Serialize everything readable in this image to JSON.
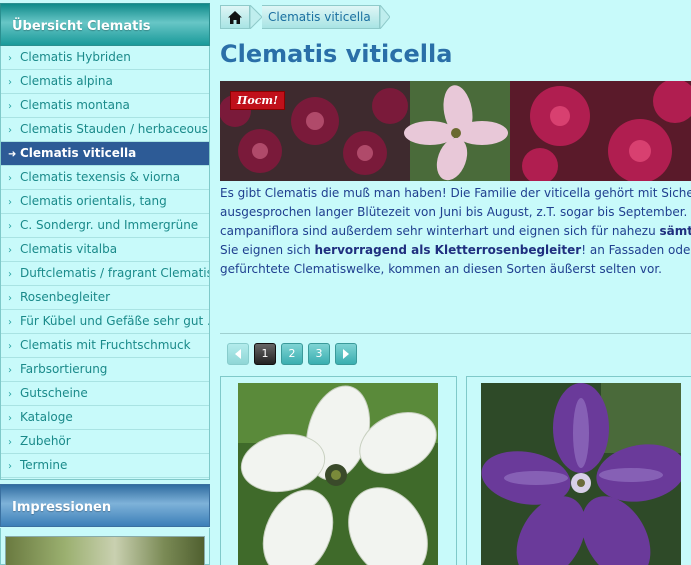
{
  "sidebar": {
    "header": "Übersicht Clematis",
    "items": [
      {
        "label": "Clematis Hybriden",
        "active": false
      },
      {
        "label": "Clematis alpina",
        "active": false
      },
      {
        "label": "Clematis montana",
        "active": false
      },
      {
        "label": "Clematis Stauden / herbaceous",
        "active": false
      },
      {
        "label": "Clematis viticella",
        "active": true
      },
      {
        "label": "Clematis texensis & viorna",
        "active": false
      },
      {
        "label": "Clematis orientalis, tang",
        "active": false
      },
      {
        "label": "C. Sondergr. und Immergrüne",
        "active": false
      },
      {
        "label": "Clematis vitalba",
        "active": false
      },
      {
        "label": "Duftclematis / fragrant Clematis",
        "active": false
      },
      {
        "label": "Rosenbegleiter",
        "active": false
      },
      {
        "label": "Für Kübel und Gefäße sehr gut ...",
        "active": false
      },
      {
        "label": "Clematis mit Fruchtschmuck",
        "active": false
      },
      {
        "label": "Farbsortierung",
        "active": false
      },
      {
        "label": "Gutscheine",
        "active": false
      },
      {
        "label": "Kataloge",
        "active": false
      },
      {
        "label": "Zubehör",
        "active": false
      },
      {
        "label": "Termine",
        "active": false
      }
    ],
    "impressions_header": "Impressionen"
  },
  "breadcrumb": {
    "home_icon": "home-icon",
    "current": "Clematis viticella"
  },
  "page": {
    "title": "Clematis viticella",
    "banner_badge": "Поcm!",
    "description": {
      "line1": "Es gibt Clematis die muß man haben! Die Familie der viticella gehört mit Sicherhe",
      "line2": "ausgesprochen langer Blütezeit von Juni bis August, z.T. sogar bis September. Di",
      "line3a": "campaniflora sind außerdem sehr winterhart und eignen sich für nahezu ",
      "line3b": "sämtlich",
      "line4a": "Sie eignen sich ",
      "line4b": "hervorragend als Kletterrosenbegleiter",
      "line4c": "! an Fassaden oder Ho",
      "line5": "gefürchtete Clematiswelke, kommen an diesen Sorten äußerst selten vor."
    }
  },
  "pagination": {
    "prev_icon": "chevron-left-icon",
    "next_icon": "chevron-right-icon",
    "pages": [
      "1",
      "2",
      "3"
    ],
    "current": "1"
  },
  "colors": {
    "background": "#c8fafa",
    "active_item": "#2d5b96",
    "link": "#1a8a8a",
    "title": "#2a6fa8"
  }
}
